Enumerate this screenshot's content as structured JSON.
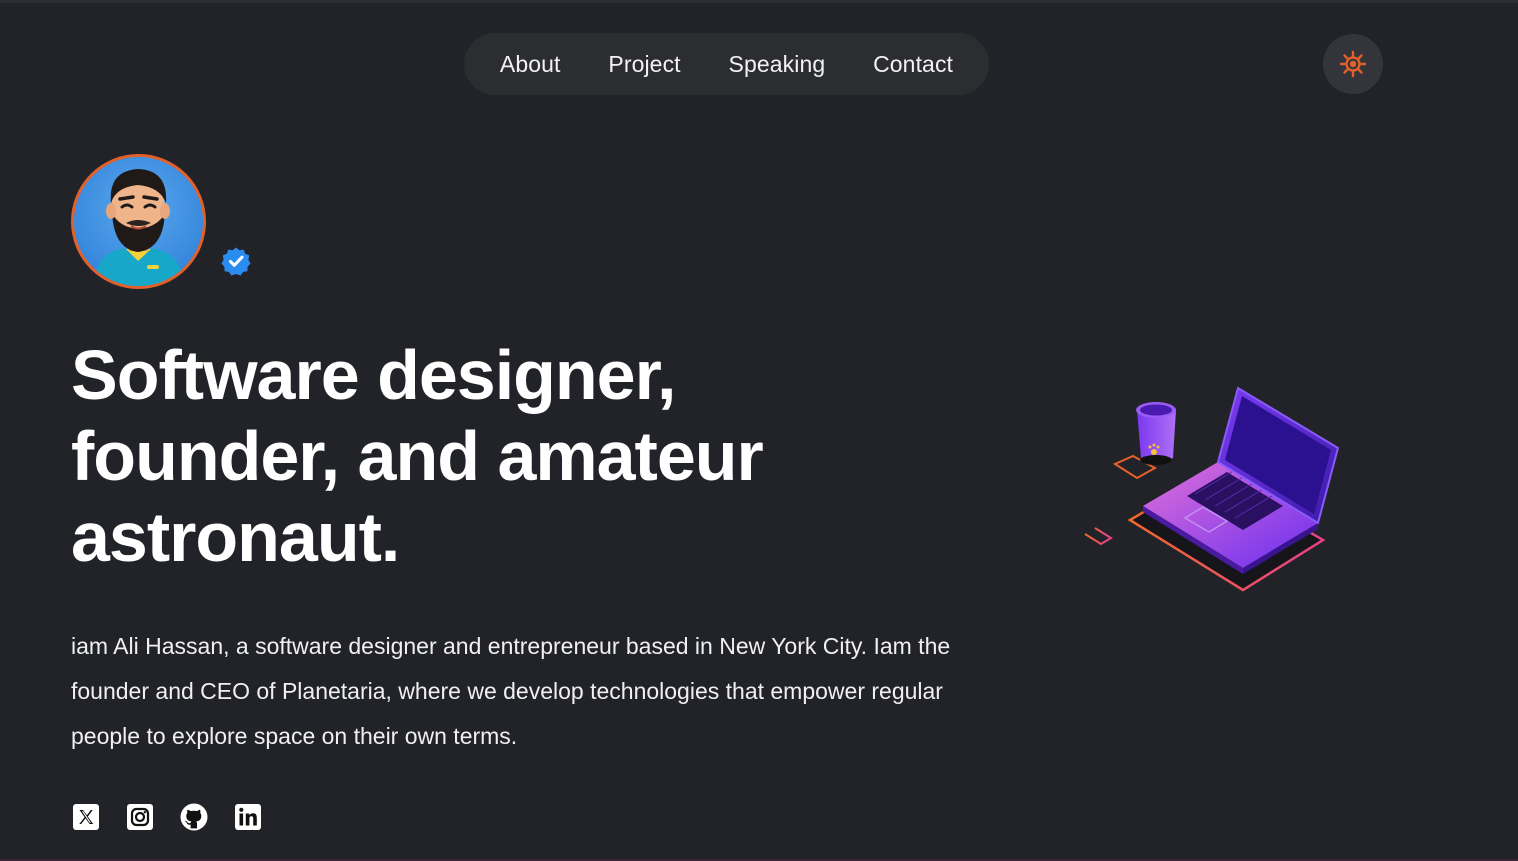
{
  "nav": {
    "items": [
      {
        "label": "About"
      },
      {
        "label": "Project"
      },
      {
        "label": "Speaking"
      },
      {
        "label": "Contact"
      }
    ]
  },
  "theme_toggle": {
    "icon": "sun-icon",
    "color": "#e2602a"
  },
  "hero": {
    "headline": "Software designer, founder, and amateur astronaut.",
    "intro": "iam Ali Hassan, a software designer and entrepreneur based in New York City. Iam the founder and CEO of Planetaria, where we develop technologies that empower regular people to explore space on their own terms."
  },
  "socials": [
    {
      "icon": "x-twitter-icon"
    },
    {
      "icon": "instagram-icon"
    },
    {
      "icon": "github-icon"
    },
    {
      "icon": "linkedin-icon"
    }
  ],
  "colors": {
    "background": "#222328",
    "accent": "#e2602a",
    "verified": "#2b8cf0"
  }
}
